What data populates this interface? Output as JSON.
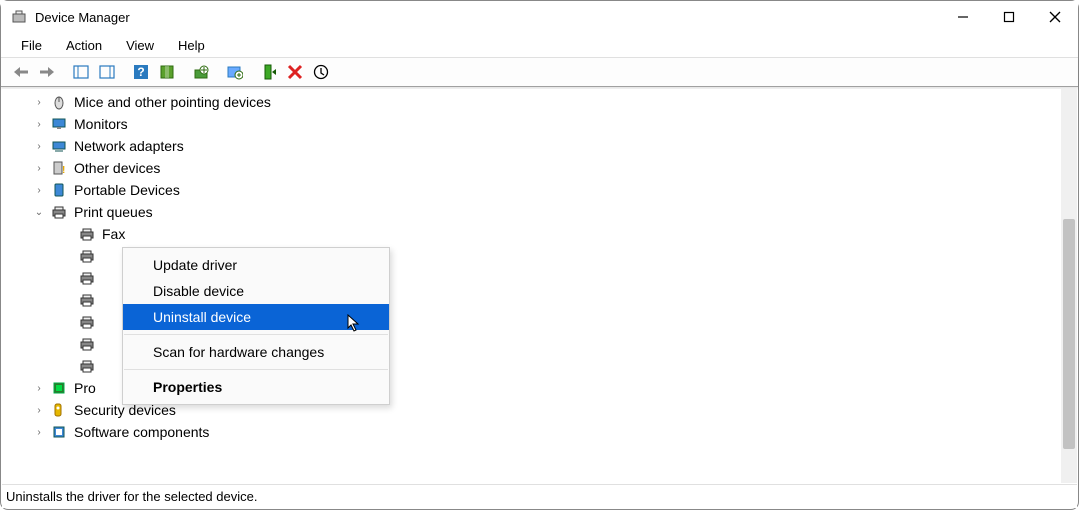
{
  "window": {
    "title": "Device Manager"
  },
  "menu": {
    "file": "File",
    "action": "Action",
    "view": "View",
    "help": "Help"
  },
  "tree": {
    "items": [
      {
        "label": "Mice and other pointing devices",
        "icon": "mouse",
        "expander": "›"
      },
      {
        "label": "Monitors",
        "icon": "monitor",
        "expander": "›"
      },
      {
        "label": "Network adapters",
        "icon": "network",
        "expander": "›"
      },
      {
        "label": "Other devices",
        "icon": "other",
        "expander": "›"
      },
      {
        "label": "Portable Devices",
        "icon": "portable",
        "expander": "›"
      },
      {
        "label": "Print queues",
        "icon": "printer",
        "expander": "⌄"
      },
      {
        "label": "Fax",
        "icon": "printer",
        "level": 2
      },
      {
        "label": "",
        "icon": "printer",
        "level": 2
      },
      {
        "label": "",
        "icon": "printer",
        "level": 2
      },
      {
        "label": "",
        "icon": "printer",
        "level": 2
      },
      {
        "label": "",
        "icon": "printer",
        "level": 2
      },
      {
        "label": "",
        "icon": "printer",
        "level": 2
      },
      {
        "label": "",
        "icon": "printer",
        "level": 2
      },
      {
        "label": "Pro",
        "icon": "processor",
        "expander": "›"
      },
      {
        "label": "Security devices",
        "icon": "security",
        "expander": "›"
      },
      {
        "label": "Software components",
        "icon": "software",
        "expander": "›"
      }
    ]
  },
  "context_menu": {
    "update": "Update driver",
    "disable": "Disable device",
    "uninstall": "Uninstall device",
    "scan": "Scan for hardware changes",
    "properties": "Properties"
  },
  "statusbar": {
    "text": "Uninstalls the driver for the selected device."
  }
}
